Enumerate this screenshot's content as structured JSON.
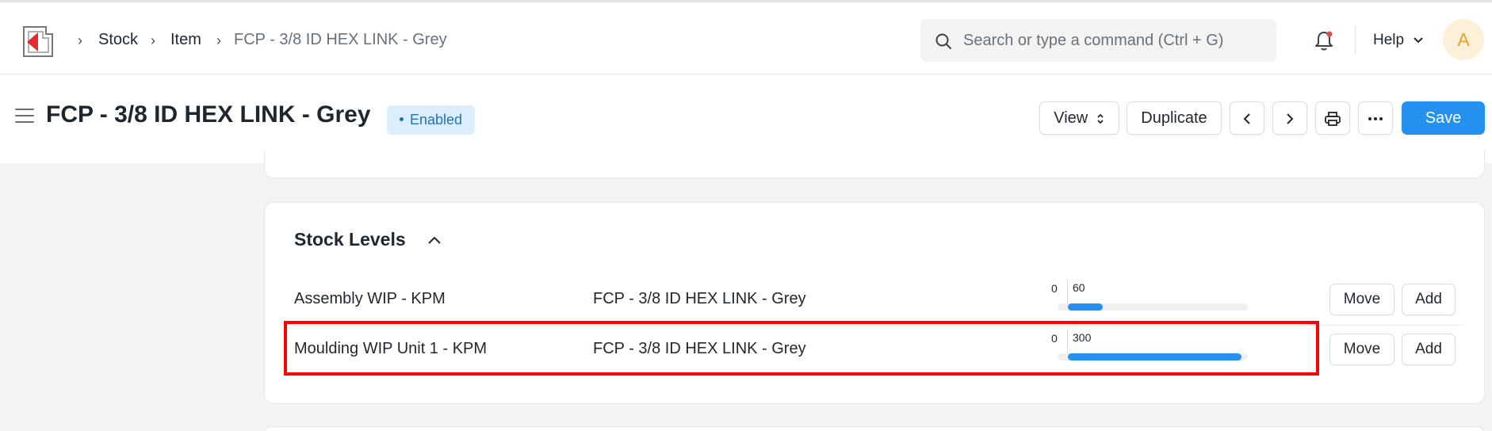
{
  "navbar": {
    "breadcrumbs": [
      "Stock",
      "Item",
      "FCP - 3/8 ID HEX LINK - Grey"
    ],
    "search_placeholder": "Search or type a command (Ctrl + G)",
    "help_label": "Help",
    "avatar_initial": "A"
  },
  "page": {
    "title": "FCP - 3/8 ID HEX LINK - Grey",
    "status": "Enabled",
    "actions": {
      "view_label": "View",
      "duplicate_label": "Duplicate",
      "save_label": "Save"
    }
  },
  "stock_levels": {
    "title": "Stock Levels",
    "rows": [
      {
        "warehouse": "Assembly WIP - KPM",
        "item": "FCP - 3/8 ID HEX LINK - Grey",
        "min": "0",
        "qty": "60",
        "qty_value": 60,
        "move_label": "Move",
        "add_label": "Add",
        "highlighted": false
      },
      {
        "warehouse": "Moulding WIP Unit 1 - KPM",
        "item": "FCP - 3/8 ID HEX LINK - Grey",
        "min": "0",
        "qty": "300",
        "qty_value": 300,
        "move_label": "Move",
        "add_label": "Add",
        "highlighted": true
      }
    ]
  },
  "colors": {
    "primary": "#2490ef",
    "highlight": "#ff0000",
    "badge_bg": "#dbeeff",
    "badge_text": "#2171b5"
  },
  "icons": [
    "logo-icon",
    "chevron-right-icon",
    "search-icon",
    "bell-icon",
    "chevron-down-icon",
    "hamburger-icon",
    "sort-icon",
    "chevron-left-icon",
    "printer-icon",
    "more-icon",
    "chevron-up-icon"
  ]
}
